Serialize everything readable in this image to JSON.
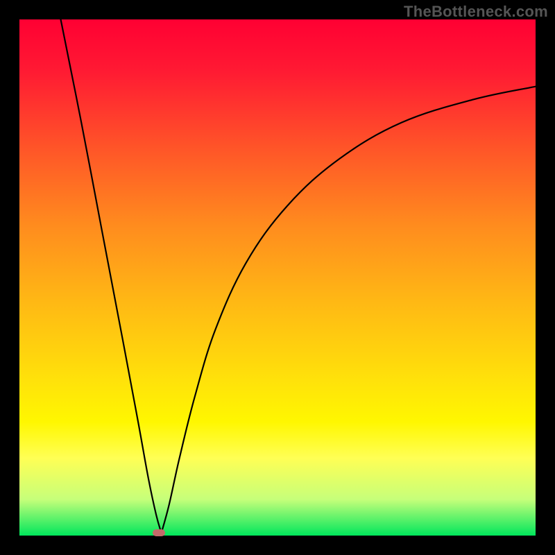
{
  "watermark": "TheBottleneck.com",
  "colors": {
    "page_bg": "#000000",
    "gradient_top": "#ff0033",
    "gradient_mid": "#fff700",
    "gradient_bottom": "#00e65c",
    "curve": "#000000",
    "marker": "#c46a6a"
  },
  "chart_data": {
    "type": "line",
    "title": "",
    "xlabel": "",
    "ylabel": "",
    "xlim": [
      0,
      100
    ],
    "ylim": [
      0,
      100
    ],
    "grid": false,
    "legend": false,
    "note": "x/y as percentage of plot area; y=100 is top, y=0 is bottom. Curve has a sharp V-shaped minimum near x≈27 and rises asymptotically toward the right.",
    "series": [
      {
        "name": "left-branch",
        "x": [
          8,
          12,
          16,
          20,
          23,
          25,
          26.5,
          27.5
        ],
        "y": [
          100,
          80,
          59,
          38,
          22,
          11,
          4,
          0.5
        ]
      },
      {
        "name": "right-branch",
        "x": [
          27.5,
          29,
          31,
          34,
          38,
          44,
          52,
          62,
          74,
          88,
          100
        ],
        "y": [
          0.5,
          6,
          15,
          27,
          40,
          53,
          64,
          73,
          80,
          84.5,
          87
        ]
      }
    ],
    "marker": {
      "x_percent": 27.0,
      "y_percent": 0.5
    }
  }
}
